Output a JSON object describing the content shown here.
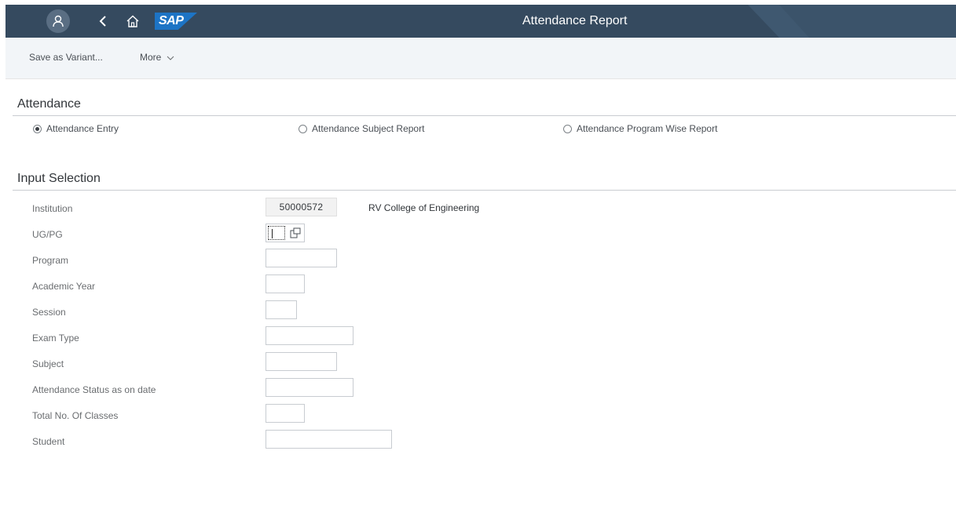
{
  "shell": {
    "title": "Attendance Report",
    "logo_text": "SAP",
    "icons": [
      "user-icon",
      "back-arrow-icon",
      "home-icon"
    ]
  },
  "toolbar": {
    "save_variant_label": "Save as Variant...",
    "more_label": "More"
  },
  "attendance": {
    "title": "Attendance",
    "options": [
      {
        "label": "Attendance Entry",
        "selected": true
      },
      {
        "label": "Attendance Subject Report",
        "selected": false
      },
      {
        "label": "Attendance Program Wise Report",
        "selected": false
      }
    ]
  },
  "input_selection": {
    "title": "Input Selection",
    "institution": {
      "label": "Institution",
      "value": "50000572",
      "description": "RV College of Engineering"
    },
    "ugpg": {
      "label": "UG/PG",
      "value": ""
    },
    "program": {
      "label": "Program",
      "value": ""
    },
    "academic_year": {
      "label": "Academic Year",
      "value": ""
    },
    "session": {
      "label": "Session",
      "value": ""
    },
    "exam_type": {
      "label": "Exam Type",
      "value": ""
    },
    "subject": {
      "label": "Subject",
      "value": ""
    },
    "attendance_status": {
      "label": "Attendance Status as on date",
      "value": ""
    },
    "total_classes": {
      "label": "Total No. Of Classes",
      "value": ""
    },
    "student": {
      "label": "Student",
      "value": ""
    }
  },
  "colors": {
    "shell_bar": "#354a5f",
    "toolbar_bg": "#f2f5f8",
    "sap_blue": "#1d74c5"
  }
}
